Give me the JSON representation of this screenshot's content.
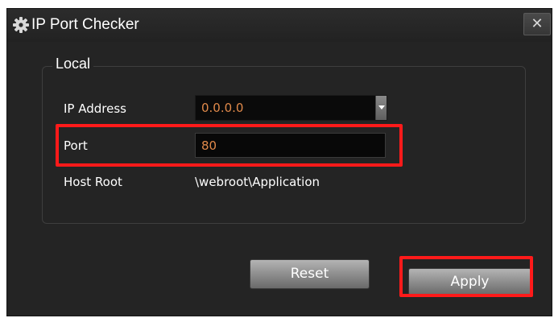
{
  "window": {
    "title": "IP Port Checker",
    "close_glyph": "✕",
    "title_icon": "gear-icon"
  },
  "local": {
    "group_title": "Local",
    "ip_address": {
      "label": "IP Address",
      "value": "0.0.0.0"
    },
    "port": {
      "label": "Port",
      "value": "80"
    },
    "host_root": {
      "label": "Host Root",
      "value": "\\webroot\\Application"
    }
  },
  "buttons": {
    "reset_label": "Reset",
    "apply_label": "Apply"
  },
  "colors": {
    "background": "#242424",
    "field_value": "#e0894a",
    "highlight": "#ff1a1a"
  }
}
